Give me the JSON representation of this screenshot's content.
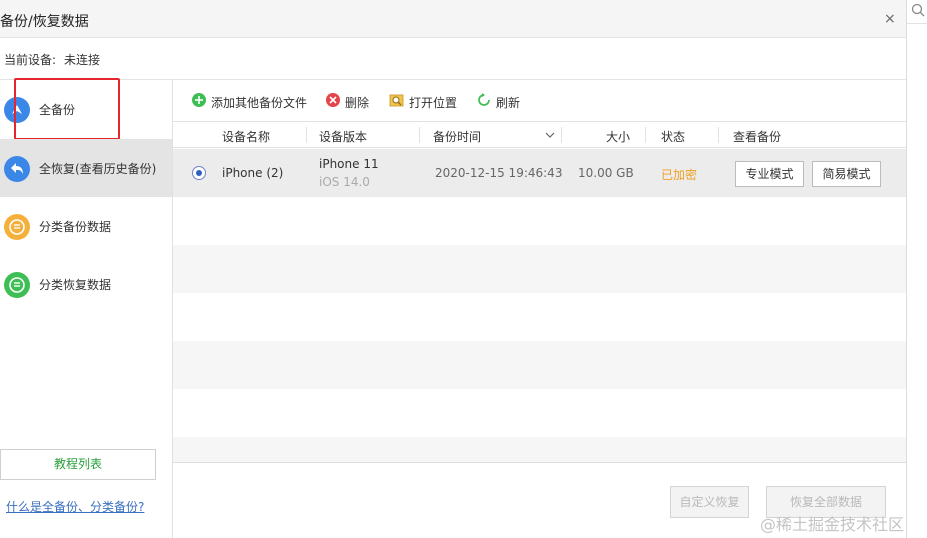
{
  "window": {
    "title": "备份/恢复数据",
    "close": "×"
  },
  "device": {
    "label": "当前设备:",
    "status": "未连接"
  },
  "sidebar": {
    "items": [
      {
        "label": "全备份",
        "icon": "arrow-up-circle-icon",
        "color": "#3b87e8"
      },
      {
        "label": "全恢复(查看历史备份)",
        "icon": "arrow-back-circle-icon",
        "color": "#3b87e8"
      },
      {
        "label": "分类备份数据",
        "icon": "category-backup-icon",
        "color": "#f5b03c"
      },
      {
        "label": "分类恢复数据",
        "icon": "category-restore-icon",
        "color": "#3fbe55"
      }
    ],
    "tutorial_button": "教程列表",
    "help_link": "什么是全备份、分类备份?"
  },
  "toolbar": {
    "add": "添加其他备份文件",
    "delete": "删除",
    "open_location": "打开位置",
    "refresh": "刷新"
  },
  "table": {
    "columns": [
      "设备名称",
      "设备版本",
      "备份时间",
      "大小",
      "状态",
      "查看备份"
    ],
    "rows": [
      {
        "name": "iPhone (2)",
        "model": "iPhone 11",
        "os": "iOS 14.0",
        "time": "2020-12-15 19:46:43",
        "size": "10.00 GB",
        "status": "已加密",
        "pro_mode": "专业模式",
        "easy_mode": "简易模式",
        "selected": true
      }
    ]
  },
  "footer": {
    "custom_restore": "自定义恢复",
    "restore_all": "恢复全部数据"
  },
  "watermark": "@稀土掘金技术社区",
  "colors": {
    "accent_blue": "#3b87e8",
    "status_orange": "#f0a020",
    "link_blue": "#3a6fbf",
    "tutorial_green": "#2a9d3b",
    "highlight_red": "#e5262c"
  }
}
